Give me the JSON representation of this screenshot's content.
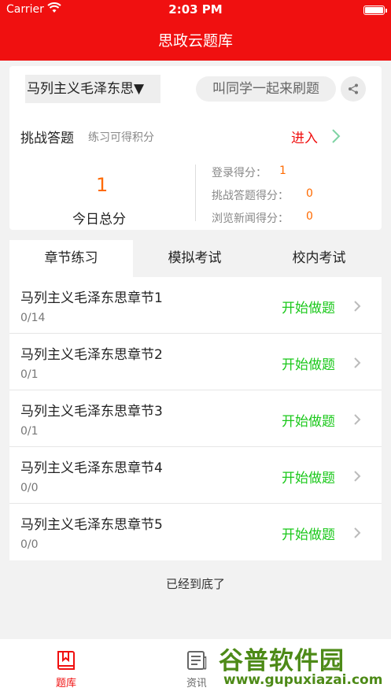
{
  "status_bar": {
    "carrier": "Carrier",
    "time": "2:03 PM"
  },
  "header": {
    "title": "思政云题库"
  },
  "subject_picker": {
    "value": "马列主义毛泽东思"
  },
  "invite": {
    "label": "叫同学一起来刷题"
  },
  "challenge": {
    "title": "挑战答题",
    "hint": "练习可得积分",
    "enter_label": "进入"
  },
  "today": {
    "total": "1",
    "label": "今日总分"
  },
  "scores": [
    {
      "label": "登录得分：",
      "value": "1"
    },
    {
      "label": "挑战答题得分：",
      "value": "0"
    },
    {
      "label": "浏览新闻得分：",
      "value": "0"
    }
  ],
  "tabs": [
    {
      "label": "章节练习",
      "active": true
    },
    {
      "label": "模拟考试",
      "active": false
    },
    {
      "label": "校内考试",
      "active": false
    }
  ],
  "chapters": [
    {
      "title": "马列主义毛泽东思章节1",
      "progress": "0/14",
      "action": "开始做题"
    },
    {
      "title": "马列主义毛泽东思章节2",
      "progress": "0/1",
      "action": "开始做题"
    },
    {
      "title": "马列主义毛泽东思章节3",
      "progress": "0/1",
      "action": "开始做题"
    },
    {
      "title": "马列主义毛泽东思章节4",
      "progress": "0/0",
      "action": "开始做题"
    },
    {
      "title": "马列主义毛泽东思章节5",
      "progress": "0/0",
      "action": "开始做题"
    }
  ],
  "list_end": "已经到底了",
  "tabbar": [
    {
      "label": "题库",
      "icon": "bookmark-book-icon",
      "active": true
    },
    {
      "label": "资讯",
      "icon": "news-icon",
      "active": false
    }
  ],
  "watermark": {
    "text": "谷普软件园",
    "url": "www.gupuxiazai.com"
  },
  "colors": {
    "brand": "#f01010",
    "accent_orange": "#ff6a00",
    "action_green": "#1ac81a"
  }
}
